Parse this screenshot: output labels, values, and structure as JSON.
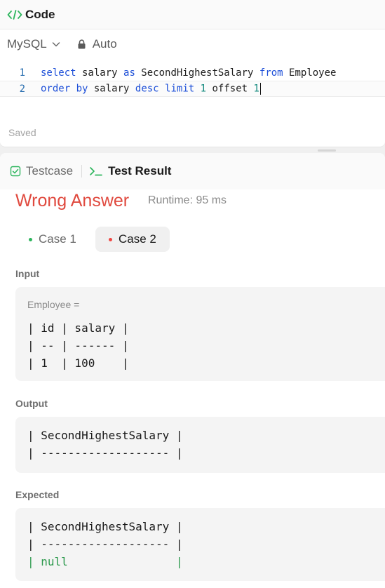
{
  "code_panel": {
    "title": "Code",
    "language": "MySQL",
    "mode": "Auto",
    "saved_status": "Saved",
    "lines": [
      {
        "number": "1",
        "tokens": [
          {
            "t": "select",
            "k": "kw"
          },
          {
            "t": " salary ",
            "k": "plain"
          },
          {
            "t": "as",
            "k": "kw"
          },
          {
            "t": " SecondHighestSalary ",
            "k": "plain"
          },
          {
            "t": "from",
            "k": "kw"
          },
          {
            "t": " Employee",
            "k": "plain"
          }
        ]
      },
      {
        "number": "2",
        "tokens": [
          {
            "t": "order",
            "k": "kw"
          },
          {
            "t": " ",
            "k": "plain"
          },
          {
            "t": "by",
            "k": "kw"
          },
          {
            "t": " salary ",
            "k": "plain"
          },
          {
            "t": "desc",
            "k": "kw"
          },
          {
            "t": " ",
            "k": "plain"
          },
          {
            "t": "limit",
            "k": "kw"
          },
          {
            "t": " ",
            "k": "plain"
          },
          {
            "t": "1",
            "k": "num"
          },
          {
            "t": " offset ",
            "k": "plain"
          },
          {
            "t": "1",
            "k": "num"
          }
        ]
      }
    ]
  },
  "tabs": {
    "testcase": "Testcase",
    "test_result": "Test Result"
  },
  "result": {
    "verdict": "Wrong Answer",
    "runtime": "Runtime: 95 ms",
    "cases": [
      {
        "label": "Case 1",
        "status_color": "#2db55d"
      },
      {
        "label": "Case 2",
        "status_color": "#ef4743"
      }
    ],
    "input": {
      "label": "Input",
      "variable": "Employee =",
      "lines": [
        "| id | salary |",
        "| -- | ------ |",
        "| 1  | 100    |"
      ]
    },
    "output": {
      "label": "Output",
      "lines": [
        "| SecondHighestSalary |",
        "| ------------------- |"
      ]
    },
    "expected": {
      "label": "Expected",
      "lines": [
        "| SecondHighestSalary |",
        "| ------------------- |"
      ],
      "diff_line": "| null                |"
    }
  },
  "colors": {
    "verdict": "#e04a3f",
    "keyword": "#1d4fd8",
    "number": "#138a7e",
    "accent_green": "#2db55d"
  }
}
